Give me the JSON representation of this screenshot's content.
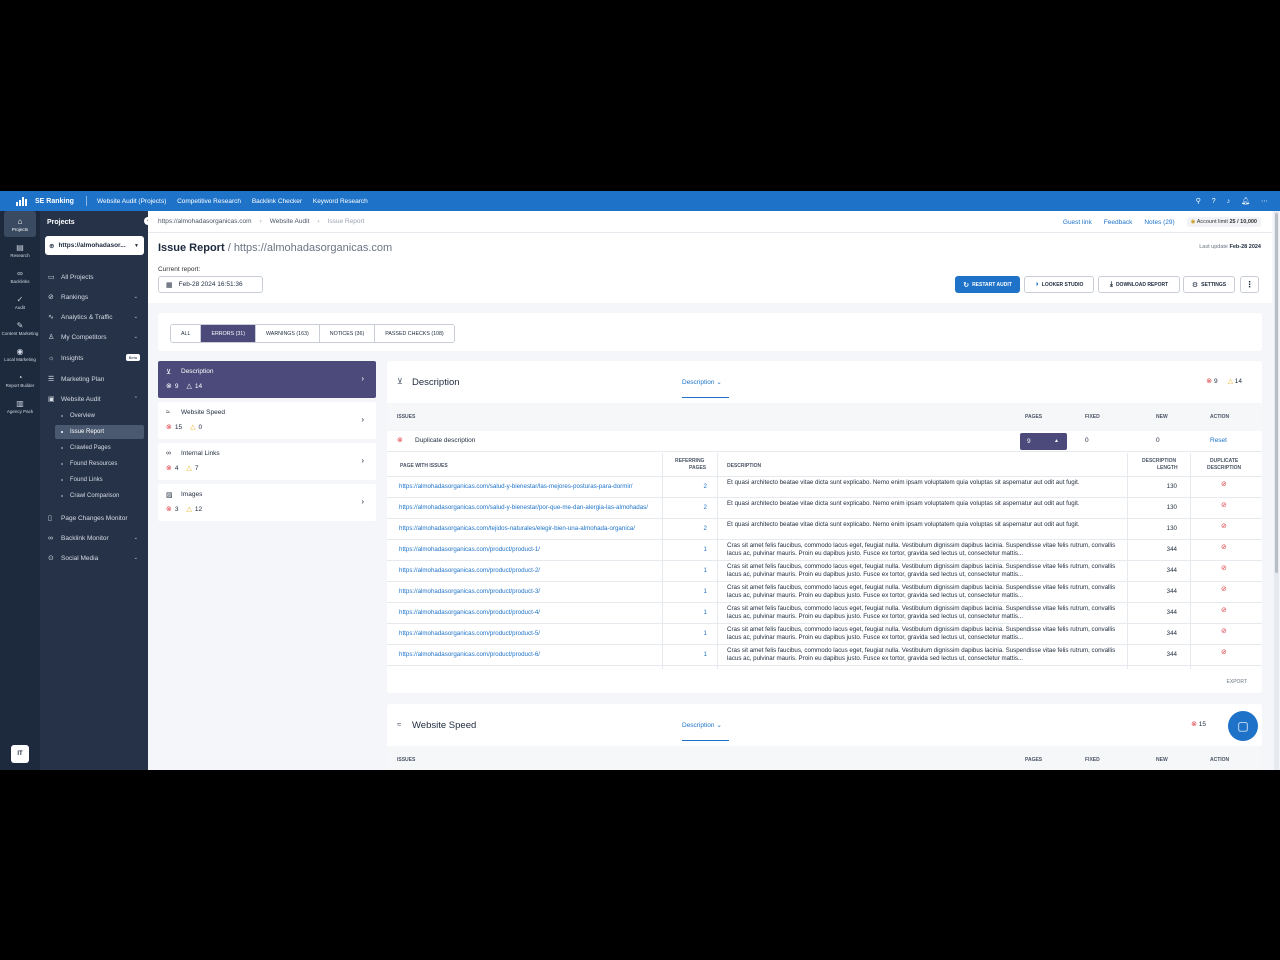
{
  "topbar": {
    "brand": "SE Ranking",
    "nav": [
      "Website Audit (Projects)",
      "Competitive Research",
      "Backlink Checker",
      "Keyword Research"
    ]
  },
  "rail": [
    {
      "label": "Projects",
      "icon": "home-icon"
    },
    {
      "label": "Research",
      "icon": "research-icon"
    },
    {
      "label": "Backlinks",
      "icon": "link-icon"
    },
    {
      "label": "Audit",
      "icon": "check-circle-icon"
    },
    {
      "label": "Content Marketing",
      "icon": "pen-icon"
    },
    {
      "label": "Local Marketing",
      "icon": "pin-icon"
    },
    {
      "label": "Report Builder",
      "icon": "report-icon"
    },
    {
      "label": "Agency Pack",
      "icon": "building-icon"
    }
  ],
  "user": {
    "initials": "IT"
  },
  "sidebar": {
    "title": "Projects",
    "project": "https://almohadasor...",
    "items": [
      {
        "label": "All Projects",
        "icon": "folder-icon"
      },
      {
        "label": "Rankings",
        "icon": "chart-icon"
      },
      {
        "label": "Analytics & Traffic",
        "icon": "analytics-icon"
      },
      {
        "label": "My Competitors",
        "icon": "competitors-icon"
      },
      {
        "label": "Insights",
        "icon": "bulb-icon",
        "badge": "Beta"
      },
      {
        "label": "Marketing Plan",
        "icon": "plan-icon"
      },
      {
        "label": "Website Audit",
        "icon": "audit-icon"
      }
    ],
    "sub_items": [
      "Overview",
      "Issue Report",
      "Crawled Pages",
      "Found Resources",
      "Found Links",
      "Crawl Comparison"
    ],
    "bottom_items": [
      {
        "label": "Page Changes Monitor",
        "icon": "monitor-icon"
      },
      {
        "label": "Backlink Monitor",
        "icon": "backlink-icon"
      },
      {
        "label": "Social Media",
        "icon": "social-icon"
      }
    ]
  },
  "breadcrumb": {
    "project": "https://almohadasorganicas.com",
    "section": "Website Audit",
    "current": "Issue Report"
  },
  "top_links": {
    "guest": "Guest link",
    "feedback": "Feedback",
    "notes": "Notes (29)",
    "account_label": "Account limit",
    "account_value": "25 / 10,000"
  },
  "header": {
    "title": "Issue Report",
    "url": "/ https://almohadasorganicas.com",
    "last_update_label": "Last update",
    "last_update": "Feb-28 2024",
    "current_label": "Current report:",
    "date": "Feb-28 2024 16:51:36"
  },
  "toolbar": {
    "restart": "RESTART AUDIT",
    "looker": "LOOKER STUDIO",
    "download": "DOWNLOAD REPORT",
    "settings": "SETTINGS"
  },
  "tabs": [
    "ALL",
    "ERRORS (31)",
    "WARNINGS (163)",
    "NOTICES (36)",
    "PASSED CHECKS (108)"
  ],
  "categories": [
    {
      "name": "Description",
      "errors": "9",
      "warnings": "14",
      "icon": "description-icon"
    },
    {
      "name": "Website Speed",
      "errors": "15",
      "warnings": "0",
      "icon": "speed-icon"
    },
    {
      "name": "Internal Links",
      "errors": "4",
      "warnings": "7",
      "icon": "link-icon"
    },
    {
      "name": "Images",
      "errors": "3",
      "warnings": "12",
      "icon": "image-icon"
    }
  ],
  "detail": {
    "title": "Description",
    "selector": "Description",
    "errors": "9",
    "warnings": "14",
    "columns": {
      "issues": "ISSUES",
      "pages": "PAGES",
      "fixed": "FIXED",
      "new": "NEW",
      "action": "ACTION"
    },
    "issue": {
      "name": "Duplicate description",
      "pages": "9",
      "fixed": "0",
      "new": "0",
      "action": "Reset"
    },
    "sub_columns": {
      "page": "PAGE WITH ISSUES",
      "ref1": "REFERRING",
      "ref2": "PAGES",
      "desc": "DESCRIPTION",
      "len1": "DESCRIPTION",
      "len2": "LENGTH",
      "dup1": "DUPLICATE",
      "dup2": "DESCRIPTION"
    },
    "rows": [
      {
        "url": "https://almohadasorganicas.com/salud-y-bienestar/las-mejores-posturas-para-dormir/",
        "ref": "2",
        "desc": "Et quasi architecto beatae vitae dicta sunt explicabo. Nemo enim ipsam voluptatem quia voluptas sit aspernatur aut odit aut fugit.",
        "len": "130"
      },
      {
        "url": "https://almohadasorganicas.com/salud-y-bienestar/por-que-me-dan-alergia-las-almohadas/",
        "ref": "2",
        "desc": "Et quasi architecto beatae vitae dicta sunt explicabo. Nemo enim ipsam voluptatem quia voluptas sit aspernatur aut odit aut fugit.",
        "len": "130"
      },
      {
        "url": "https://almohadasorganicas.com/tejidos-naturales/elegir-bien-una-almohada-organica/",
        "ref": "2",
        "desc": "Et quasi architecto beatae vitae dicta sunt explicabo. Nemo enim ipsam voluptatem quia voluptas sit aspernatur aut odit aut fugit.",
        "len": "130"
      },
      {
        "url": "https://almohadasorganicas.com/product/product-1/",
        "ref": "1",
        "desc": "Cras sit amet felis faucibus, commodo lacus eget, feugiat nulla. Vestibulum dignissim dapibus lacinia. Suspendisse vitae felis rutrum, convallis lacus ac, pulvinar mauris. Proin eu dapibus justo. Fusce ex tortor, gravida sed lectus ut, consectetur mattis...",
        "len": "344"
      },
      {
        "url": "https://almohadasorganicas.com/product/product-2/",
        "ref": "1",
        "desc": "Cras sit amet felis faucibus, commodo lacus eget, feugiat nulla. Vestibulum dignissim dapibus lacinia. Suspendisse vitae felis rutrum, convallis lacus ac, pulvinar mauris. Proin eu dapibus justo. Fusce ex tortor, gravida sed lectus ut, consectetur mattis...",
        "len": "344"
      },
      {
        "url": "https://almohadasorganicas.com/product/product-3/",
        "ref": "1",
        "desc": "Cras sit amet felis faucibus, commodo lacus eget, feugiat nulla. Vestibulum dignissim dapibus lacinia. Suspendisse vitae felis rutrum, convallis lacus ac, pulvinar mauris. Proin eu dapibus justo. Fusce ex tortor, gravida sed lectus ut, consectetur mattis...",
        "len": "344"
      },
      {
        "url": "https://almohadasorganicas.com/product/product-4/",
        "ref": "1",
        "desc": "Cras sit amet felis faucibus, commodo lacus eget, feugiat nulla. Vestibulum dignissim dapibus lacinia. Suspendisse vitae felis rutrum, convallis lacus ac, pulvinar mauris. Proin eu dapibus justo. Fusce ex tortor, gravida sed lectus ut, consectetur mattis...",
        "len": "344"
      },
      {
        "url": "https://almohadasorganicas.com/product/product-5/",
        "ref": "1",
        "desc": "Cras sit amet felis faucibus, commodo lacus eget, feugiat nulla. Vestibulum dignissim dapibus lacinia. Suspendisse vitae felis rutrum, convallis lacus ac, pulvinar mauris. Proin eu dapibus justo. Fusce ex tortor, gravida sed lectus ut, consectetur mattis...",
        "len": "344"
      },
      {
        "url": "https://almohadasorganicas.com/product/product-6/",
        "ref": "1",
        "desc": "Cras sit amet felis faucibus, commodo lacus eget, feugiat nulla. Vestibulum dignissim dapibus lacinia. Suspendisse vitae felis rutrum, convallis lacus ac, pulvinar mauris. Proin eu dapibus justo. Fusce ex tortor, gravida sed lectus ut, consectetur mattis...",
        "len": "344"
      }
    ],
    "export": "EXPORT"
  },
  "detail2": {
    "title": "Website Speed",
    "selector": "Description",
    "errors": "15"
  },
  "colors": {
    "brand": "#1e73c9",
    "active_tab": "#4c4a7a",
    "error": "#e0434a",
    "warning": "#f0b429",
    "sidebar": "#263247"
  }
}
